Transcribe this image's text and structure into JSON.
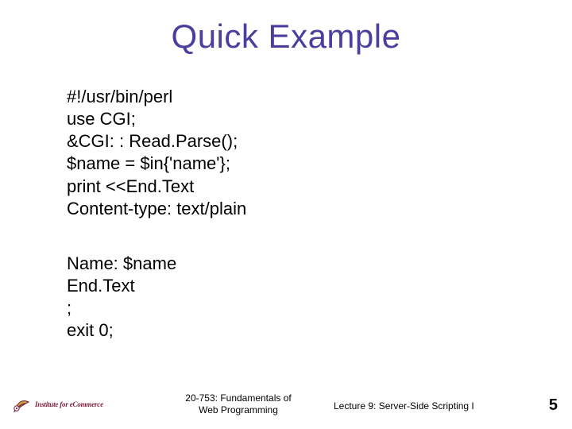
{
  "title": "Quick Example",
  "code": {
    "l1": "#!/usr/bin/perl",
    "l2": "use CGI;",
    "l3": "&CGI: : Read.Parse();",
    "l4": "$name = $in{'name'};",
    "l5": "print <<End.Text",
    "l6": "Content-type: text/plain",
    "l7": "Name: $name",
    "l8": "End.Text",
    "l9": ";",
    "l10": "exit 0;"
  },
  "footer": {
    "logo_text": "Institute for eCommerce",
    "course_line1": "20-753: Fundamentals of",
    "course_line2": "Web Programming",
    "lecture": "Lecture 9: Server-Side Scripting I",
    "page": "5"
  }
}
